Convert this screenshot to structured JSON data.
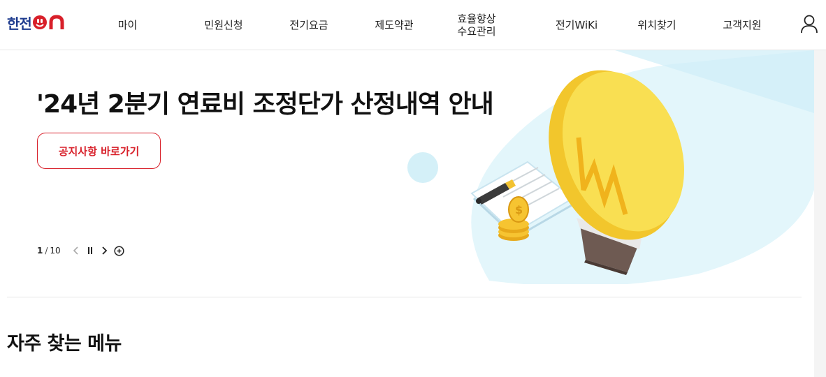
{
  "header": {
    "logo": {
      "korean": "한전",
      "on": "ON"
    },
    "nav": [
      {
        "label": "마이"
      },
      {
        "label": "민원신청"
      },
      {
        "label": "전기요금"
      },
      {
        "label": "제도약관"
      },
      {
        "line1": "효율향상",
        "line2": "수요관리"
      },
      {
        "label": "전기WiKi"
      },
      {
        "label": "위치찾기"
      },
      {
        "label": "고객지원"
      }
    ],
    "user_icon": "user-icon"
  },
  "hero": {
    "title": "'24년 2분기 연료비 조정단가 산정내역 안내",
    "button_label": "공지사항 바로가기",
    "pager": {
      "current": "1",
      "separator": "/",
      "total": "10"
    },
    "controls": [
      "chevron-left-icon",
      "pause-icon",
      "chevron-right-icon",
      "plus-circle-icon"
    ],
    "illustration": "lightbulb-document-coins-illustration"
  },
  "frequent_menu": {
    "title": "자주 찾는 메뉴"
  },
  "colors": {
    "brand_red": "#d8202a",
    "brand_blue": "#1f3c8f",
    "bulb_yellow": "#f7d93a",
    "sky_blue": "#e3f6fb"
  }
}
